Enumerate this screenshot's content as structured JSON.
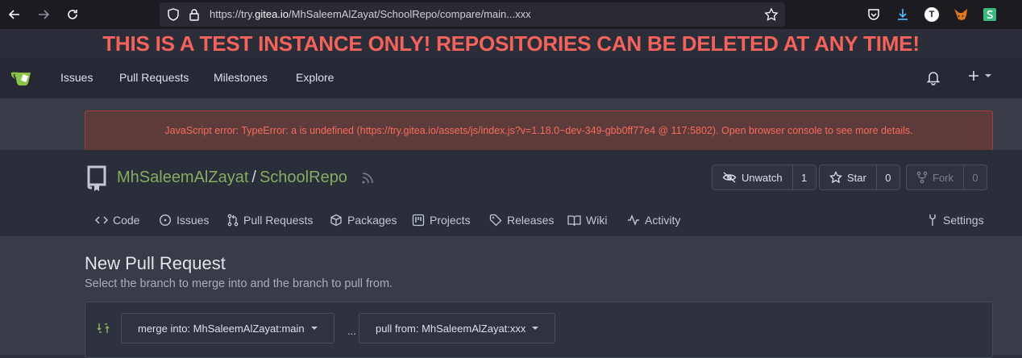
{
  "browser": {
    "url_prefix": "https://try.",
    "url_host": "gitea.io",
    "url_path": "/MhSaleemAlZayat/SchoolRepo/compare/main...xxx",
    "ext_t_label": "T"
  },
  "banner": {
    "text": "THIS IS A TEST INSTANCE ONLY! REPOSITORIES CAN BE DELETED AT ANY TIME!"
  },
  "topnav": {
    "items": [
      "Issues",
      "Pull Requests",
      "Milestones",
      "Explore"
    ]
  },
  "error": {
    "message": "JavaScript error: TypeError: a is undefined (https://try.gitea.io/assets/js/index.js?v=1.18.0~dev-349-gbb0ff77e4 @ 117:5802). Open browser console to see more details."
  },
  "repo": {
    "owner": "MhSaleemAlZayat",
    "separator": "/",
    "name": "SchoolRepo",
    "watch_label": "Unwatch",
    "watch_count": "1",
    "star_label": "Star",
    "star_count": "0",
    "fork_label": "Fork",
    "fork_count": "0",
    "tabs": {
      "code": "Code",
      "issues": "Issues",
      "pulls": "Pull Requests",
      "packages": "Packages",
      "projects": "Projects",
      "releases": "Releases",
      "wiki": "Wiki",
      "activity": "Activity",
      "settings": "Settings"
    }
  },
  "compare": {
    "title": "New Pull Request",
    "subtitle": "Select the branch to merge into and the branch to pull from.",
    "merge_into": "merge into: MhSaleemAlZayat:main",
    "dots": "...",
    "pull_from": "pull from: MhSaleemAlZayat:xxx"
  },
  "colors": {
    "accent": "#87ab63",
    "error_text": "#f66b5c",
    "banner_text": "#f3625b"
  }
}
